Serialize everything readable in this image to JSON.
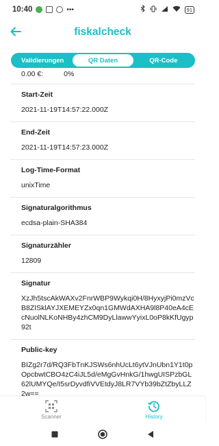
{
  "status_bar": {
    "time": "10:40",
    "battery": "91"
  },
  "header": {
    "title": "fiskalcheck"
  },
  "tabs": [
    {
      "label": "Validierungen",
      "active": false
    },
    {
      "label": "QR Daten",
      "active": true
    },
    {
      "label": "QR-Code",
      "active": false
    }
  ],
  "top_fragment": {
    "amount": "0.00 €:",
    "percent": "0%"
  },
  "fields": [
    {
      "label": "Start-Zeit",
      "value": "2021-11-19T14:57:22.000Z"
    },
    {
      "label": "End-Zeit",
      "value": "2021-11-19T14:57:23.000Z"
    },
    {
      "label": "Log-Time-Format",
      "value": "unixTime"
    },
    {
      "label": "Signaturalgorithmus",
      "value": "ecdsa-plain-SHA384"
    },
    {
      "label": "Signaturzähler",
      "value": "12809"
    },
    {
      "label": "Signatur",
      "value": "XzJh5tscAkWAXv2FnrWBP9Wykqi0H/8HyxyjPi0mzVcB8ZISklAYJXEMEYZx0qn1GMWdAXHA9l8P40eA4cEcNuolNLKoNHBy4zhCM9DyLlawwYyixL0oP8kKfUgyp92t"
    },
    {
      "label": "Public-key",
      "value": "BIZg2r7d/RQ3FbTnKJSWs6nhUcLt6ytVJnUbn1Y1t0pOpcbwtCBO4zC4iJL5d/eMgGvHnkG/1hwgUISPzbGL62lUMYQe/I5srDyvdfiVVEtdyJ8LR7VYb39bZtZbyLLZ2w=="
    }
  ],
  "bottom_nav": [
    {
      "label": "Scanner",
      "icon": "qr-scanner-icon",
      "active": false
    },
    {
      "label": "History",
      "icon": "history-icon",
      "active": true
    }
  ],
  "colors": {
    "accent": "#1bbfc5",
    "inactive": "#8a8a8a"
  }
}
